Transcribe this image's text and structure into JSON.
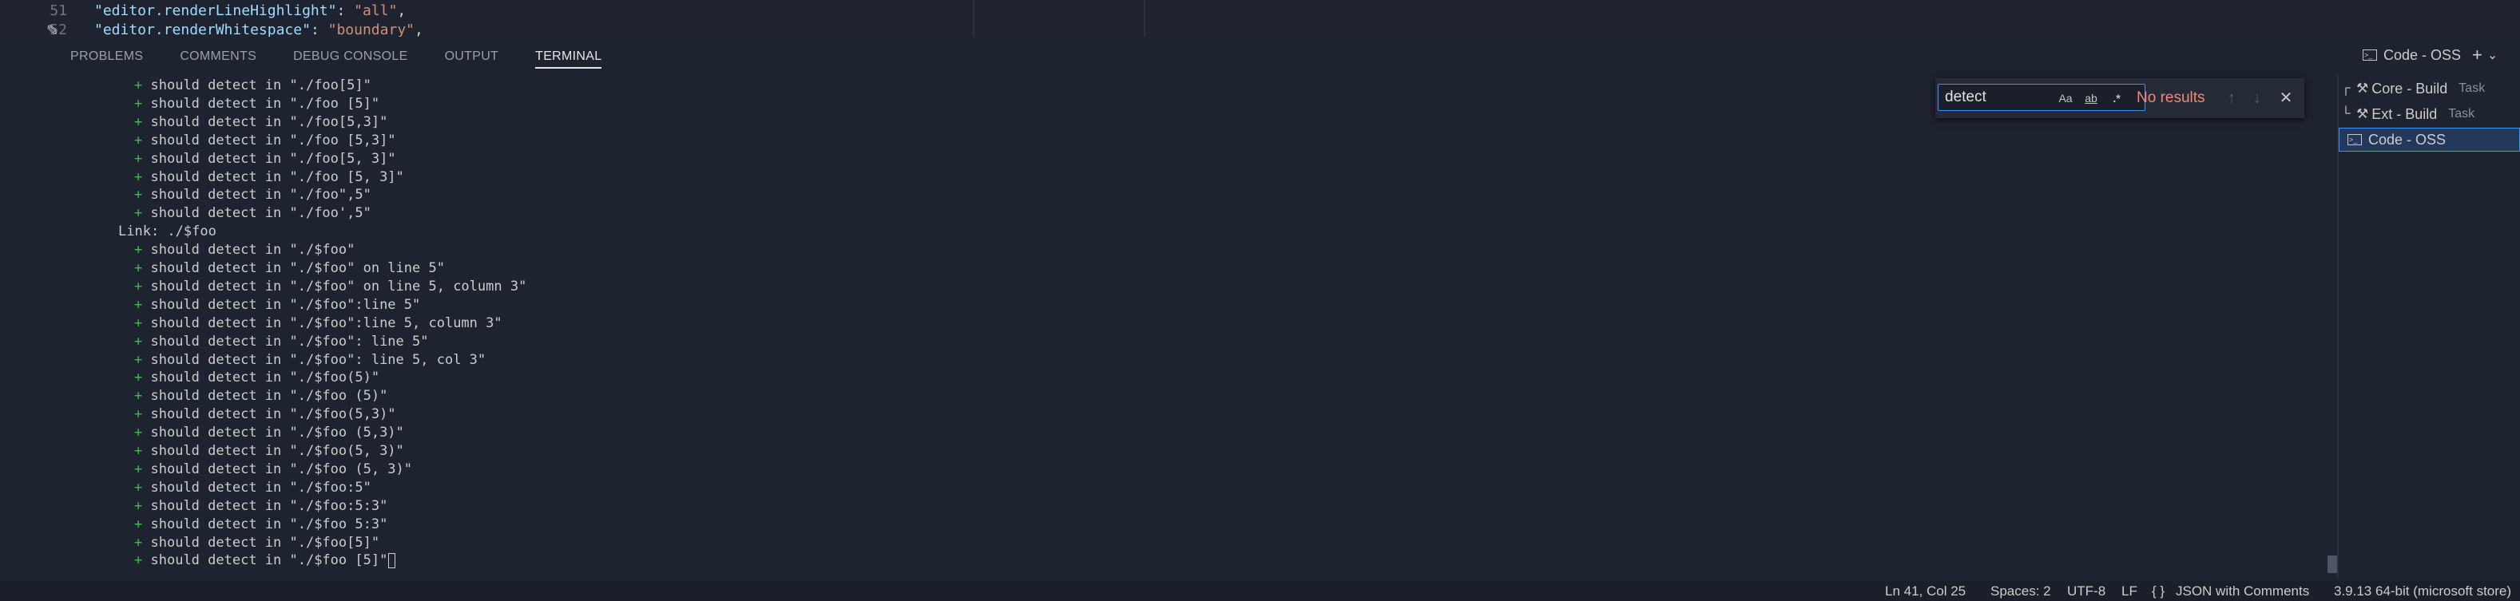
{
  "editor": {
    "lines": [
      {
        "num": "51",
        "key": "\"editor.renderLineHighlight\"",
        "value": "\"all\"",
        "trail": ","
      },
      {
        "num": "52",
        "key": "\"editor.renderWhitespace\"",
        "value": "\"boundary\"",
        "trail": ","
      }
    ],
    "icons": {
      "gutter": "pencil-icon"
    }
  },
  "panel": {
    "tabs": [
      {
        "label": "PROBLEMS"
      },
      {
        "label": "COMMENTS"
      },
      {
        "label": "DEBUG CONSOLE"
      },
      {
        "label": "OUTPUT"
      },
      {
        "label": "TERMINAL",
        "active": true
      }
    ],
    "header_title": "Code - OSS",
    "header_icons": [
      "terminal-icon",
      "plus-icon",
      "chevron-down-icon"
    ]
  },
  "terminal": {
    "lines": [
      {
        "plus": "+",
        "text": "should detect in \"./foo[5]\""
      },
      {
        "plus": "+",
        "text": "should detect in \"./foo [5]\""
      },
      {
        "plus": "+",
        "text": "should detect in \"./foo[5,3]\""
      },
      {
        "plus": "+",
        "text": "should detect in \"./foo [5,3]\""
      },
      {
        "plus": "+",
        "text": "should detect in \"./foo[5, 3]\""
      },
      {
        "plus": "+",
        "text": "should detect in \"./foo [5, 3]\""
      },
      {
        "plus": "+",
        "text": "should detect in \"./foo\",5\""
      },
      {
        "plus": "+",
        "text": "should detect in \"./foo',5\""
      },
      {
        "heading": "Link: ./$foo"
      },
      {
        "plus": "+",
        "text": "should detect in \"./$foo\""
      },
      {
        "plus": "+",
        "text": "should detect in \"./$foo\" on line 5\""
      },
      {
        "plus": "+",
        "text": "should detect in \"./$foo\" on line 5, column 3\""
      },
      {
        "plus": "+",
        "text": "should detect in \"./$foo\":line 5\""
      },
      {
        "plus": "+",
        "text": "should detect in \"./$foo\":line 5, column 3\""
      },
      {
        "plus": "+",
        "text": "should detect in \"./$foo\": line 5\""
      },
      {
        "plus": "+",
        "text": "should detect in \"./$foo\": line 5, col 3\""
      },
      {
        "plus": "+",
        "text": "should detect in \"./$foo(5)\""
      },
      {
        "plus": "+",
        "text": "should detect in \"./$foo (5)\""
      },
      {
        "plus": "+",
        "text": "should detect in \"./$foo(5,3)\""
      },
      {
        "plus": "+",
        "text": "should detect in \"./$foo (5,3)\""
      },
      {
        "plus": "+",
        "text": "should detect in \"./$foo(5, 3)\""
      },
      {
        "plus": "+",
        "text": "should detect in \"./$foo (5, 3)\""
      },
      {
        "plus": "+",
        "text": "should detect in \"./$foo:5\""
      },
      {
        "plus": "+",
        "text": "should detect in \"./$foo:5:3\""
      },
      {
        "plus": "+",
        "text": "should detect in \"./$foo 5:3\""
      },
      {
        "plus": "+",
        "text": "should detect in \"./$foo[5]\""
      },
      {
        "plus": "+",
        "text": "should detect in \"./$foo [5]\"",
        "cursor": true
      }
    ]
  },
  "find": {
    "value": "detect",
    "options": {
      "match_case": "Aa",
      "whole_word": "ab",
      "regex": ".*"
    },
    "status": "No results",
    "icons": [
      "arrow-up-icon",
      "arrow-down-icon",
      "close-icon"
    ]
  },
  "terminal_list": [
    {
      "tree": "┌",
      "name": "Core - Build",
      "badge": "Task",
      "icon": "tools-icon"
    },
    {
      "tree": "└",
      "name": "Ext - Build",
      "badge": "Task",
      "icon": "tools-icon"
    },
    {
      "name": "Code - OSS",
      "icon": "terminal-icon",
      "active": true
    }
  ],
  "status_bar": {
    "position": "Ln 41, Col 25",
    "spaces": "Spaces: 2",
    "encoding": "UTF-8",
    "eol": "LF",
    "language_icon": "{ }",
    "language": "JSON with Comments",
    "interpreter": "3.9.13 64-bit (microsoft store)"
  },
  "colors": {
    "accent": "#3794ff",
    "status_error": "#f48771",
    "diff_plus": "#3fb950"
  }
}
